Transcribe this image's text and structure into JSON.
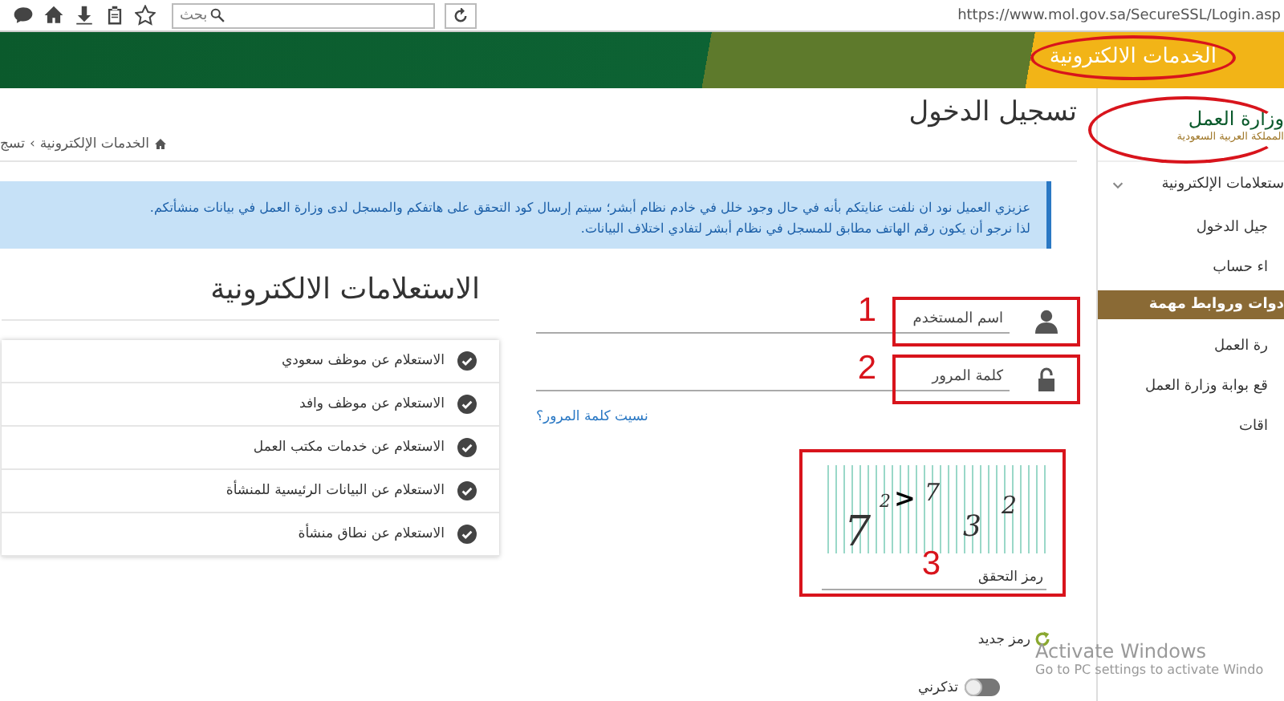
{
  "browser": {
    "search": {
      "placeholder": "بحث"
    },
    "url": "https://www.mol.gov.sa/SecureSSL/Login.asp"
  },
  "banner": {
    "title": "الخدمات الالكترونية",
    "circled": true
  },
  "logo": {
    "name": "وزارة العمل",
    "subtitle": "المملكة العربية السعودية",
    "circled": true
  },
  "page": {
    "title": "تسجيل الدخول",
    "breadcrumb": [
      "الخدمات الإلكترونية",
      "تسج"
    ],
    "breadcrumb_separator": "›"
  },
  "sidebar": {
    "items": [
      {
        "label": "ستعلامات الإلكترونية",
        "kind": "group",
        "expanded": true
      },
      {
        "label": "جيل الدخول",
        "kind": "link"
      },
      {
        "label": "اء حساب",
        "kind": "link"
      },
      {
        "label": "دوات وروابط مهمة",
        "kind": "header"
      },
      {
        "label": "رة العمل",
        "kind": "link"
      },
      {
        "label": "قع بوابة وزارة العمل",
        "kind": "link"
      },
      {
        "label": "اقات",
        "kind": "link"
      }
    ]
  },
  "alert": {
    "lines": [
      "عزيزي العميل نود ان نلفت عنايتكم بأنه في حال وجود خلل في خادم نظام أبشر؛ سيتم إرسال كود التحقق على هاتفكم والمسجل لدى وزارة العمل في بيانات منشأتكم.",
      "لذا نرجو أن يكون رقم الهاتف مطابق للمسجل في نظام أبشر لتفادي اختلاف البيانات."
    ]
  },
  "login": {
    "username": {
      "placeholder": "اسم المستخدم",
      "annotation": "1"
    },
    "password": {
      "placeholder": "كلمة المرور",
      "annotation": "2"
    },
    "forgot_link": "نسيت كلمة المرور؟",
    "captcha": {
      "glyphs": [
        "2",
        "3",
        "7",
        ">",
        "2",
        "7"
      ],
      "placeholder": "رمز التحقق",
      "annotation": "3"
    },
    "refresh_link": "رمز جديد",
    "remember": {
      "label": "تذكرني",
      "on": false
    }
  },
  "inquiries": {
    "title": "الاستعلامات الالكترونية",
    "items": [
      "الاستعلام عن موظف سعودي",
      "الاستعلام عن موظف وافد",
      "الاستعلام عن خدمات مكتب العمل",
      "الاستعلام عن البيانات الرئيسية للمنشأة",
      "الاستعلام عن نطاق منشأة"
    ]
  },
  "os_notice": {
    "title": "Activate Windows",
    "text": "Go to PC settings to activate Windo"
  }
}
